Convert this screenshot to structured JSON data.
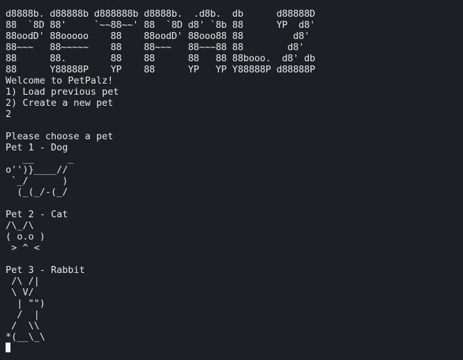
{
  "banner": [
    "d8888b. d88888b d888888b d8888b.  .d8b.  db      d88888D",
    "88  `8D 88'     `~~88~~' 88  `8D d8' `8b 88      YP  d8'",
    "88oodD' 88ooooo    88    88oodD' 88ooo88 88         d8'",
    "88~~~   88~~~~~    88    88~~~   88~~~88 88        d8'",
    "88      88.        88    88      88   88 88booo.  d8' db",
    "88      Y88888P    YP    88      YP   YP Y88888P d88888P"
  ],
  "menu": {
    "welcome": "Welcome to PetPalz!",
    "option1": "1) Load previous pet",
    "option2": "2) Create a new pet",
    "input": "2"
  },
  "prompt": "Please choose a pet",
  "pets": [
    {
      "title": "Pet 1 - Dog",
      "art": [
        "   __      _",
        "o'')}____//",
        " `_/      )",
        "  (_(_/-(_/"
      ]
    },
    {
      "title": "Pet 2 - Cat",
      "art": [
        "/\\_/\\",
        "( o.o )",
        " > ^ <"
      ]
    },
    {
      "title": "Pet 3 - Rabbit",
      "art": [
        " /\\ /|",
        " \\ V/",
        "  | \"\")",
        "  /  |",
        " /  \\\\",
        "*(__\\_\\"
      ]
    }
  ]
}
